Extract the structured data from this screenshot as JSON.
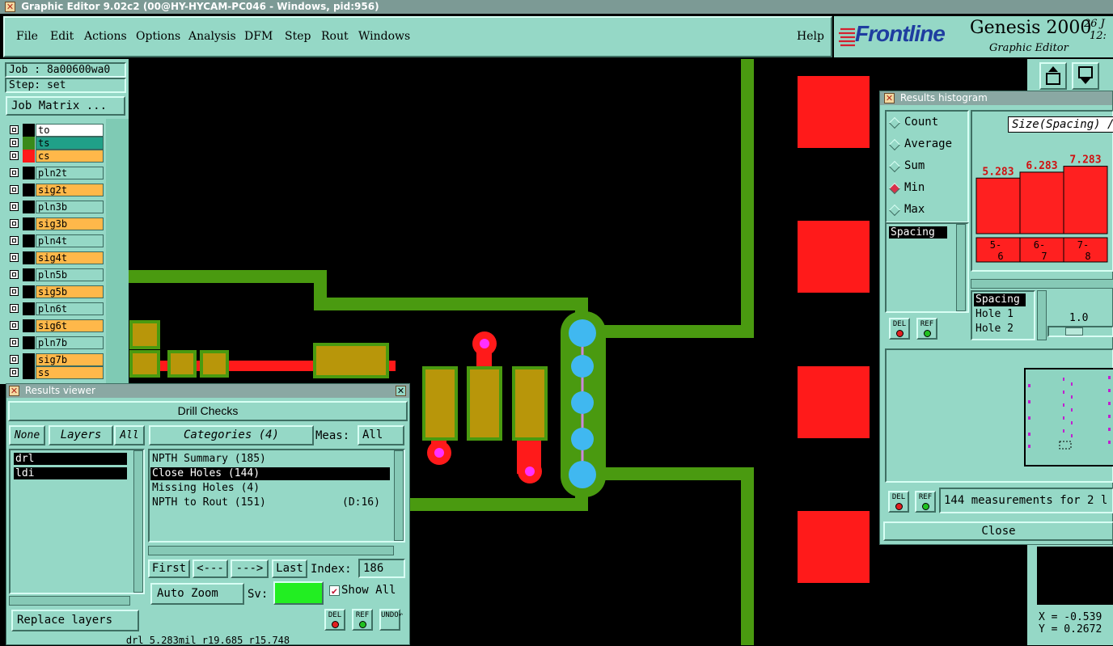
{
  "window_title": "Graphic Editor 9.02c2 (00@HY-HYCAM-PC046 - Windows, pid:956)",
  "menu": [
    "File",
    "Edit",
    "Actions",
    "Options",
    "Analysis",
    "DFM",
    "Step",
    "Rout",
    "Windows"
  ],
  "help_label": "Help",
  "brand": {
    "logo": "Frontline",
    "product": "Genesis 2000",
    "subtitle": "Graphic Editor",
    "date_fragment": "26 J",
    "time_fragment": "12:"
  },
  "job": {
    "job_label": "Job : 8a00600wa0",
    "step_label": "Step: set",
    "matrix_button": "Job Matrix ..."
  },
  "layers": [
    {
      "name": "to",
      "swatch": "#000000",
      "bg": "#ffffff"
    },
    {
      "name": "ts",
      "swatch": "#3a8a1a",
      "bg": "#20a088"
    },
    {
      "name": "cs",
      "swatch": "#ff1a1a",
      "bg": "#ffb84a"
    },
    {
      "name": "pln2t",
      "swatch": "#000000",
      "bg": "#95d8c6"
    },
    {
      "name": "sig2t",
      "swatch": "#000000",
      "bg": "#ffb84a"
    },
    {
      "name": "pln3b",
      "swatch": "#000000",
      "bg": "#95d8c6"
    },
    {
      "name": "sig3b",
      "swatch": "#000000",
      "bg": "#ffb84a"
    },
    {
      "name": "pln4t",
      "swatch": "#000000",
      "bg": "#95d8c6"
    },
    {
      "name": "sig4t",
      "swatch": "#000000",
      "bg": "#ffb84a"
    },
    {
      "name": "pln5b",
      "swatch": "#000000",
      "bg": "#95d8c6"
    },
    {
      "name": "sig5b",
      "swatch": "#000000",
      "bg": "#ffb84a"
    },
    {
      "name": "pln6t",
      "swatch": "#000000",
      "bg": "#95d8c6"
    },
    {
      "name": "sig6t",
      "swatch": "#000000",
      "bg": "#ffb84a"
    },
    {
      "name": "pln7b",
      "swatch": "#000000",
      "bg": "#95d8c6"
    },
    {
      "name": "sig7b",
      "swatch": "#000000",
      "bg": "#ffb84a"
    },
    {
      "name": "ss",
      "swatch": "#000000",
      "bg": "#ffb84a"
    }
  ],
  "results_viewer": {
    "title": "Results viewer",
    "header": "Drill Checks",
    "none_btn": "None",
    "layers_btn": "Layers",
    "all_btn": "All",
    "layer_list": [
      "drl",
      "ldi"
    ],
    "categories_btn": "Categories (4)",
    "meas_label": "Meas:",
    "meas_value": "All",
    "categories": [
      {
        "text": "NPTH Summary (185)",
        "extra": ""
      },
      {
        "text": "Close Holes (144)",
        "extra": ""
      },
      {
        "text": "Missing Holes (4)",
        "extra": ""
      },
      {
        "text": "NPTH to Rout (151)",
        "extra": "(D:16)"
      }
    ],
    "first_btn": "First",
    "prev_btn": "<---",
    "next_btn": "--->",
    "last_btn": "Last",
    "index_label": "Index:",
    "index_value": "186",
    "auto_zoom": "Auto Zoom",
    "sv_label": "Sv:",
    "show_all": "Show All",
    "replace_layers": "Replace layers",
    "del": "DEL",
    "ref": "REF",
    "undo": "UNDO",
    "status": "drl 5.283mil r19.685 r15.748"
  },
  "histogram": {
    "title": "Results histogram",
    "modes": [
      "Count",
      "Average",
      "Sum",
      "Min",
      "Max"
    ],
    "selected_mode": "Min",
    "list_item": "Spacing",
    "size_label": "Size(Spacing) /",
    "params": [
      "Spacing",
      "Hole 1",
      "Hole 2"
    ],
    "slider_value": "1.0",
    "footer_text": "144 measurements for 2 l",
    "close_btn": "Close",
    "del": "DEL",
    "ref": "REF"
  },
  "chart_data": {
    "type": "bar",
    "categories": [
      "5-6",
      "6-7",
      "7-8"
    ],
    "values": [
      5.283,
      6.283,
      7.283
    ],
    "bar_color": "#ff2020"
  },
  "coords": {
    "x": "X = -0.539",
    "y": "Y = 0.2672"
  }
}
